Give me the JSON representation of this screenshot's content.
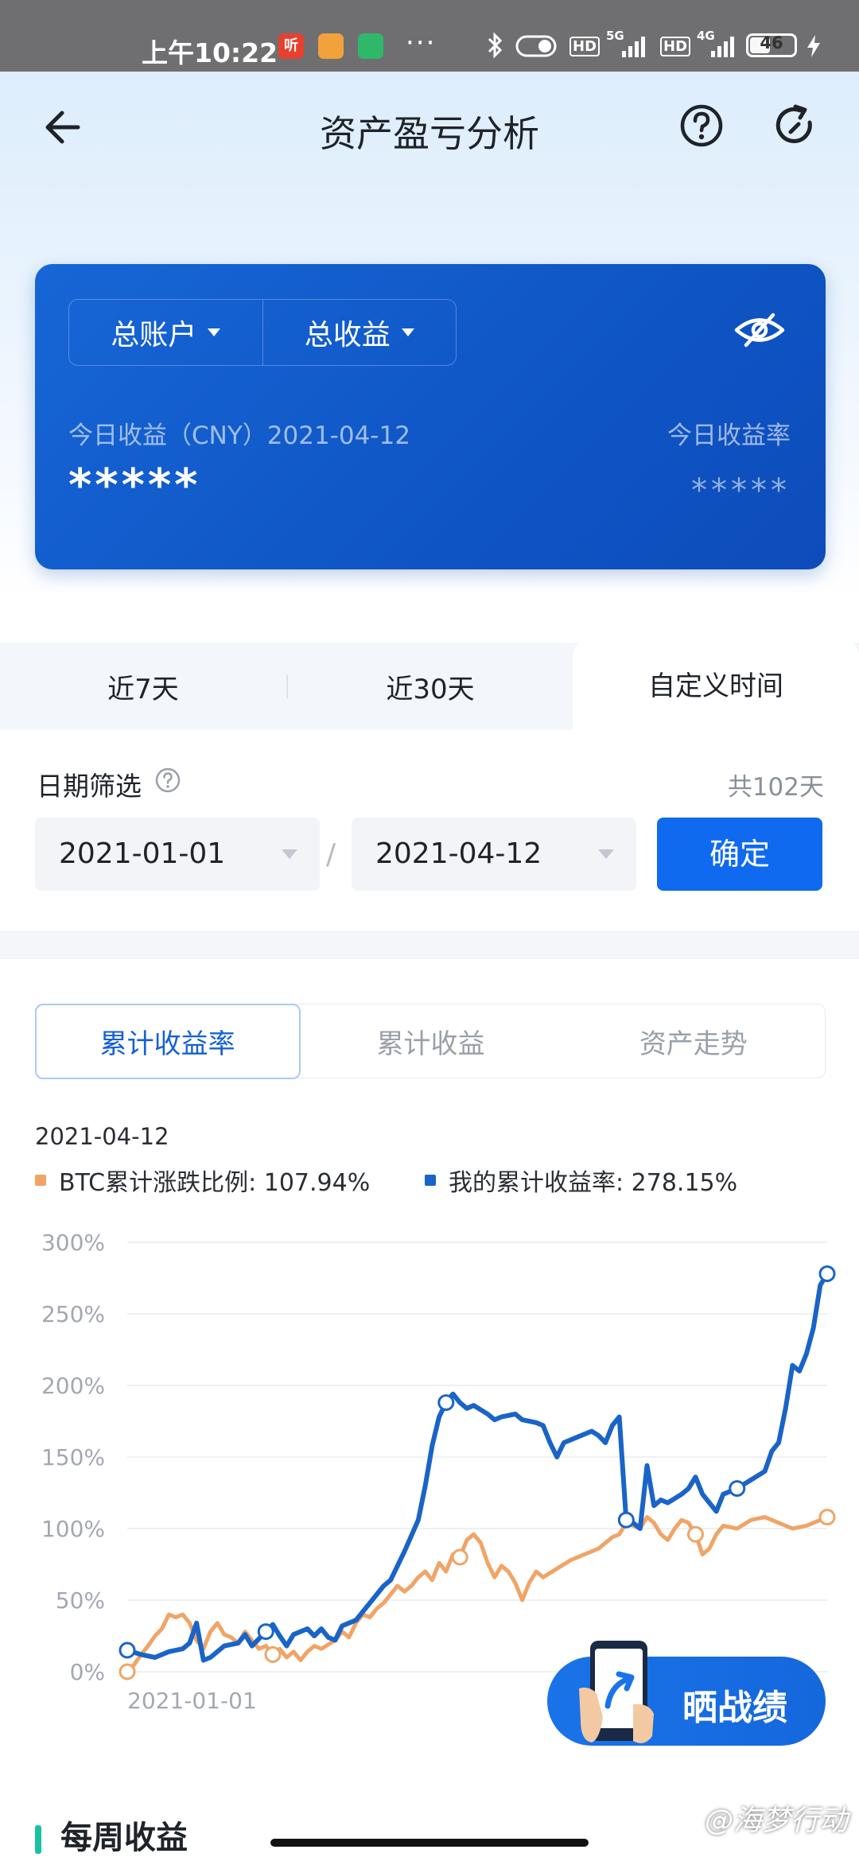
{
  "status_bar": {
    "time": "上午10:22",
    "app_badges": [
      {
        "label": "听",
        "color": "#e8402f"
      },
      {
        "label": "",
        "color": "#f2a23a"
      },
      {
        "label": "",
        "color": "#2fb86a"
      }
    ],
    "more": "···",
    "hd1": "HD",
    "net1": "5G",
    "hd2": "HD",
    "net2": "4G",
    "battery": "46"
  },
  "header": {
    "title": "资产盈亏分析"
  },
  "asset_card": {
    "account_dropdown": "总账户",
    "metric_dropdown": "总收益",
    "today_profit_label": "今日收益（CNY）2021-04-12",
    "today_rate_label": "今日收益率",
    "today_profit_value": "*****",
    "today_rate_value": "*****"
  },
  "period_tabs": {
    "items": [
      "近7天",
      "近30天",
      "自定义时间"
    ],
    "active_index": 2
  },
  "date_filter": {
    "label": "日期筛选",
    "count": "共102天",
    "start_date": "2021-01-01",
    "end_date": "2021-04-12",
    "separator": "/",
    "confirm_label": "确定"
  },
  "chart_tabs": {
    "items": [
      "累计收益率",
      "累计收益",
      "资产走势"
    ],
    "active_index": 0
  },
  "chart_date": "2021-04-12",
  "legend": {
    "btc": "BTC累计涨跌比例: 107.94%",
    "mine": "我的累计收益率: 278.15%"
  },
  "colors": {
    "btc": "#f0a466",
    "mine": "#1a64c8",
    "accent": "#0f6af0"
  },
  "chart_data": {
    "type": "line",
    "y_ticks": [
      "300%",
      "250%",
      "200%",
      "150%",
      "100%",
      "50%",
      "0%"
    ],
    "ylim": [
      0,
      300
    ],
    "x_start_label": "2021-01-01",
    "xlim": [
      0,
      101
    ],
    "series": [
      {
        "name": "我的累计收益率",
        "color": "#1a64c8",
        "points": [
          [
            0,
            15
          ],
          [
            2,
            12
          ],
          [
            4,
            10
          ],
          [
            6,
            14
          ],
          [
            8,
            16
          ],
          [
            9,
            20
          ],
          [
            10,
            34
          ],
          [
            11,
            8
          ],
          [
            12,
            10
          ],
          [
            14,
            18
          ],
          [
            16,
            20
          ],
          [
            17,
            26
          ],
          [
            18,
            18
          ],
          [
            20,
            28
          ],
          [
            21,
            33
          ],
          [
            22,
            25
          ],
          [
            23,
            18
          ],
          [
            24,
            26
          ],
          [
            26,
            30
          ],
          [
            27,
            25
          ],
          [
            28,
            30
          ],
          [
            29,
            24
          ],
          [
            30,
            22
          ],
          [
            31,
            32
          ],
          [
            33,
            36
          ],
          [
            35,
            48
          ],
          [
            37,
            60
          ],
          [
            38,
            64
          ],
          [
            40,
            84
          ],
          [
            42,
            106
          ],
          [
            43,
            130
          ],
          [
            44,
            158
          ],
          [
            45,
            178
          ],
          [
            46,
            188
          ],
          [
            47,
            194
          ],
          [
            48,
            188
          ],
          [
            49,
            184
          ],
          [
            50,
            186
          ],
          [
            52,
            180
          ],
          [
            53,
            176
          ],
          [
            54,
            178
          ],
          [
            56,
            180
          ],
          [
            57,
            176
          ],
          [
            59,
            174
          ],
          [
            60,
            172
          ],
          [
            61,
            160
          ],
          [
            62,
            150
          ],
          [
            63,
            160
          ],
          [
            65,
            164
          ],
          [
            67,
            168
          ],
          [
            68,
            165
          ],
          [
            69,
            160
          ],
          [
            70,
            172
          ],
          [
            71,
            178
          ],
          [
            72,
            106
          ],
          [
            73,
            104
          ],
          [
            74,
            100
          ],
          [
            75,
            144
          ],
          [
            76,
            116
          ],
          [
            77,
            120
          ],
          [
            78,
            118
          ],
          [
            80,
            124
          ],
          [
            81,
            128
          ],
          [
            82,
            136
          ],
          [
            83,
            124
          ],
          [
            84,
            118
          ],
          [
            85,
            112
          ],
          [
            86,
            124
          ],
          [
            88,
            128
          ],
          [
            90,
            134
          ],
          [
            92,
            140
          ],
          [
            93,
            154
          ],
          [
            94,
            160
          ],
          [
            95,
            184
          ],
          [
            96,
            214
          ],
          [
            97,
            210
          ],
          [
            98,
            222
          ],
          [
            99,
            240
          ],
          [
            100,
            270
          ],
          [
            101,
            278
          ]
        ]
      },
      {
        "name": "BTC累计涨跌比例",
        "color": "#f0a466",
        "points": [
          [
            0,
            0
          ],
          [
            1,
            5
          ],
          [
            2,
            12
          ],
          [
            3,
            18
          ],
          [
            4,
            25
          ],
          [
            5,
            30
          ],
          [
            6,
            40
          ],
          [
            7,
            38
          ],
          [
            8,
            40
          ],
          [
            9,
            34
          ],
          [
            10,
            22
          ],
          [
            11,
            16
          ],
          [
            12,
            28
          ],
          [
            13,
            34
          ],
          [
            14,
            26
          ],
          [
            15,
            24
          ],
          [
            16,
            20
          ],
          [
            17,
            28
          ],
          [
            18,
            22
          ],
          [
            19,
            16
          ],
          [
            20,
            18
          ],
          [
            21,
            12
          ],
          [
            22,
            16
          ],
          [
            23,
            10
          ],
          [
            24,
            14
          ],
          [
            25,
            8
          ],
          [
            26,
            14
          ],
          [
            27,
            18
          ],
          [
            28,
            16
          ],
          [
            30,
            22
          ],
          [
            31,
            28
          ],
          [
            32,
            24
          ],
          [
            33,
            34
          ],
          [
            34,
            40
          ],
          [
            35,
            38
          ],
          [
            36,
            44
          ],
          [
            37,
            48
          ],
          [
            38,
            54
          ],
          [
            39,
            60
          ],
          [
            40,
            56
          ],
          [
            41,
            60
          ],
          [
            42,
            66
          ],
          [
            43,
            70
          ],
          [
            44,
            64
          ],
          [
            45,
            76
          ],
          [
            46,
            70
          ],
          [
            47,
            82
          ],
          [
            48,
            80
          ],
          [
            49,
            92
          ],
          [
            50,
            96
          ],
          [
            51,
            90
          ],
          [
            52,
            76
          ],
          [
            53,
            66
          ],
          [
            54,
            74
          ],
          [
            55,
            70
          ],
          [
            56,
            62
          ],
          [
            57,
            50
          ],
          [
            58,
            62
          ],
          [
            59,
            70
          ],
          [
            60,
            66
          ],
          [
            62,
            72
          ],
          [
            64,
            78
          ],
          [
            66,
            82
          ],
          [
            68,
            86
          ],
          [
            70,
            94
          ],
          [
            71,
            96
          ],
          [
            72,
            104
          ],
          [
            73,
            102
          ],
          [
            74,
            100
          ],
          [
            75,
            108
          ],
          [
            76,
            104
          ],
          [
            77,
            96
          ],
          [
            78,
            92
          ],
          [
            79,
            100
          ],
          [
            80,
            106
          ],
          [
            81,
            104
          ],
          [
            82,
            96
          ],
          [
            83,
            82
          ],
          [
            84,
            86
          ],
          [
            85,
            96
          ],
          [
            86,
            102
          ],
          [
            88,
            100
          ],
          [
            90,
            106
          ],
          [
            92,
            108
          ],
          [
            94,
            104
          ],
          [
            96,
            100
          ],
          [
            98,
            102
          ],
          [
            99,
            104
          ],
          [
            100,
            106
          ],
          [
            101,
            108
          ]
        ]
      }
    ]
  },
  "share": {
    "label": "晒战绩"
  },
  "next_section": {
    "title": "每周收益"
  },
  "watermark": "@海梦行动"
}
